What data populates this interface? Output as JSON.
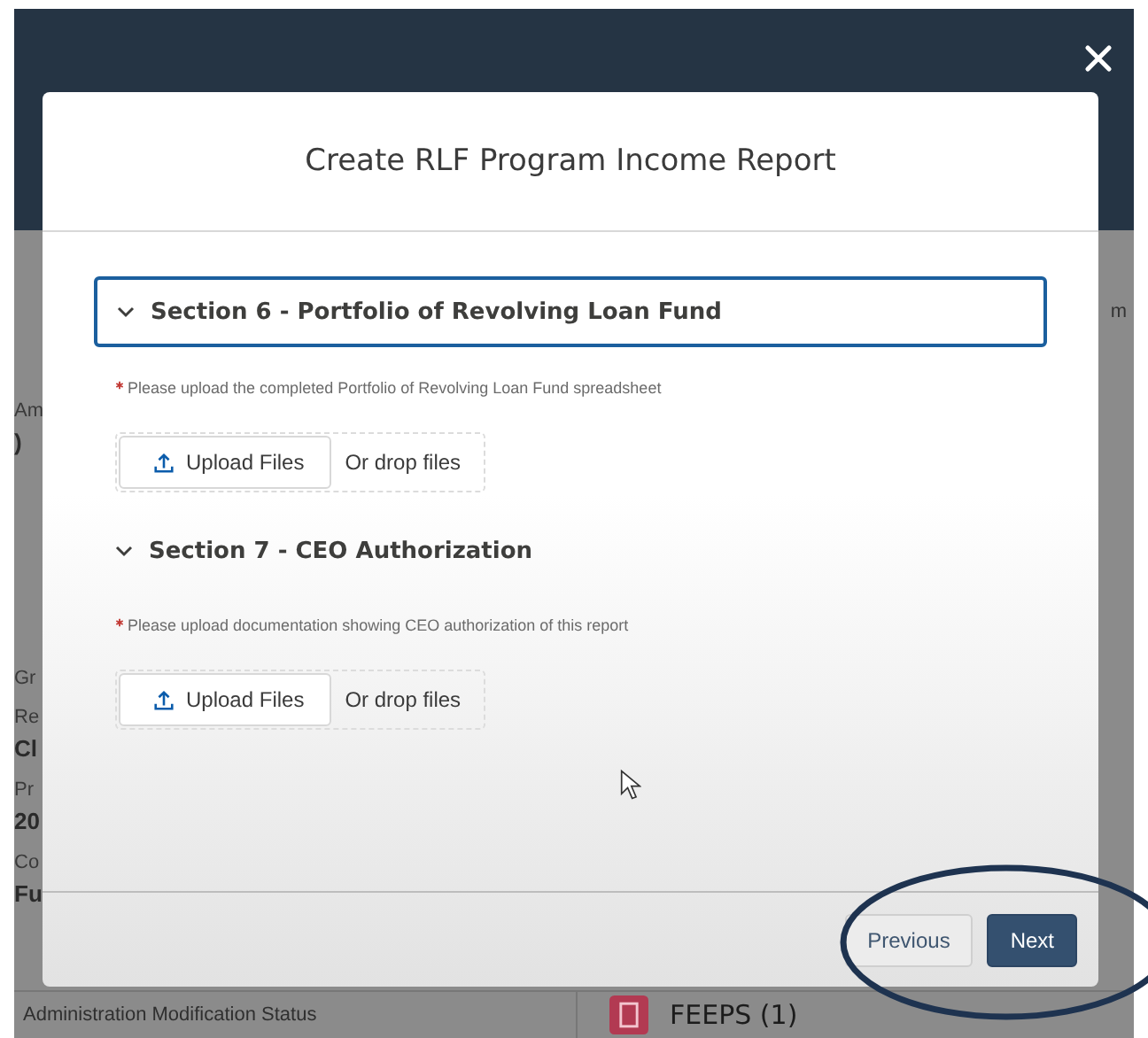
{
  "background": {
    "fields": [
      {
        "label": "Am",
        "value": ")"
      },
      {
        "label": "Gr"
      },
      {
        "label": "Re",
        "value": "Cl"
      },
      {
        "label": "Pr",
        "value": "20"
      },
      {
        "label": "Co",
        "value": "Fu"
      }
    ],
    "right_fragment": "m",
    "status_label": "Administration Modification Status",
    "related_list": {
      "title": "FEEPS (1)"
    }
  },
  "modal": {
    "title": "Create RLF Program Income Report",
    "sections": [
      {
        "title": "Section 6 - Portfolio of Revolving Loan Fund",
        "expanded": true,
        "focused": true,
        "required": true,
        "instruction": "Please upload the completed Portfolio of Revolving Loan Fund spreadsheet",
        "upload_button": "Upload Files",
        "drop_text": "Or drop files"
      },
      {
        "title": "Section 7 - CEO Authorization",
        "expanded": true,
        "focused": false,
        "required": true,
        "instruction": "Please upload documentation showing CEO authorization of this report",
        "upload_button": "Upload Files",
        "drop_text": "Or drop files"
      }
    ],
    "buttons": [
      {
        "label": "Previous",
        "kind": "neutral"
      },
      {
        "label": "Next",
        "kind": "brand"
      }
    ]
  }
}
